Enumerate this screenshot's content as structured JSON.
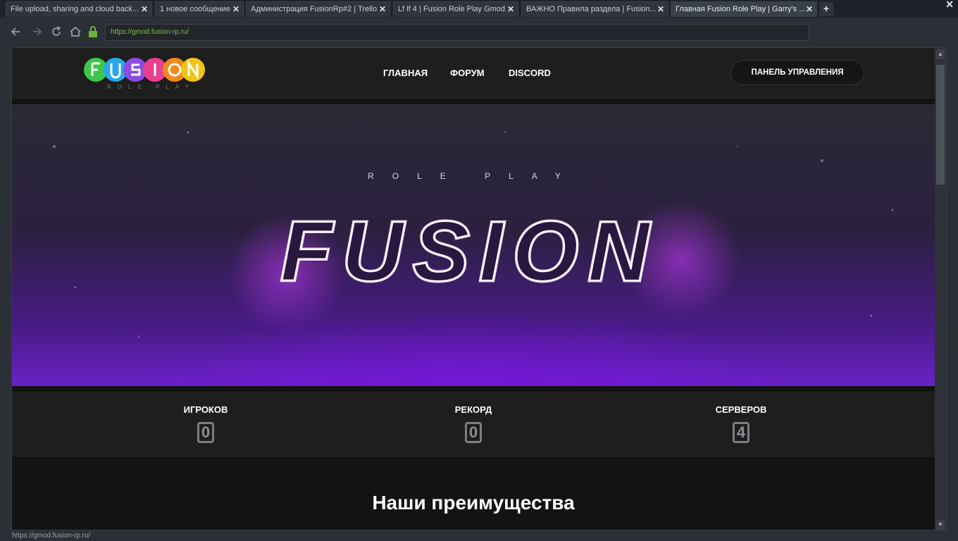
{
  "browser": {
    "tabs": [
      {
        "label": "File upload, sharing and cloud back...",
        "close": "✕"
      },
      {
        "label": "1 новое сообщение",
        "close": "✕"
      },
      {
        "label": "Администрация FusionRp#2 | Trello",
        "close": "✕"
      },
      {
        "label": "Lf lf 4 | Fusion Role Play Gmod",
        "close": "✕"
      },
      {
        "label": "ВАЖНО Правила раздела | Fusion...",
        "close": "✕"
      },
      {
        "label": "Главная Fusion Role Play | Garry's ...",
        "close": "✕"
      }
    ],
    "new_tab": "+",
    "window_close": "✕",
    "url": "https://gmod.fusion-rp.ru/",
    "status_url": "https://gmod.fusion-rp.ru/"
  },
  "site": {
    "logo": {
      "letters": [
        "F",
        "U",
        "S",
        "I",
        "O",
        "N"
      ],
      "subtitle": "ROLE PLAY"
    },
    "nav": [
      "ГЛАВНАЯ",
      "ФОРУМ",
      "DISCORD"
    ],
    "panel_button": "ПАНЕЛЬ УПРАВЛЕНИЯ",
    "hero": {
      "tagline": "ROLE PLAY",
      "title": "FUSION"
    },
    "stats": [
      {
        "label": "ИГРОКОВ",
        "value": "0"
      },
      {
        "label": "РЕКОРД",
        "value": "0"
      },
      {
        "label": "СЕРВЕРОВ",
        "value": "4"
      }
    ],
    "advantages_title": "Наши преимущества"
  },
  "colors": {
    "accent_purple": "#b84cff",
    "url_green": "#7fbf4d",
    "logo_circles": [
      "#3cc64a",
      "#2aa7e8",
      "#8a4de0",
      "#e8408f",
      "#f08a1c",
      "#f2c417"
    ]
  },
  "icons": {
    "back": "arrow-left-icon",
    "forward": "arrow-right-icon",
    "reload": "reload-icon",
    "home": "home-icon",
    "lock": "lock-icon"
  }
}
